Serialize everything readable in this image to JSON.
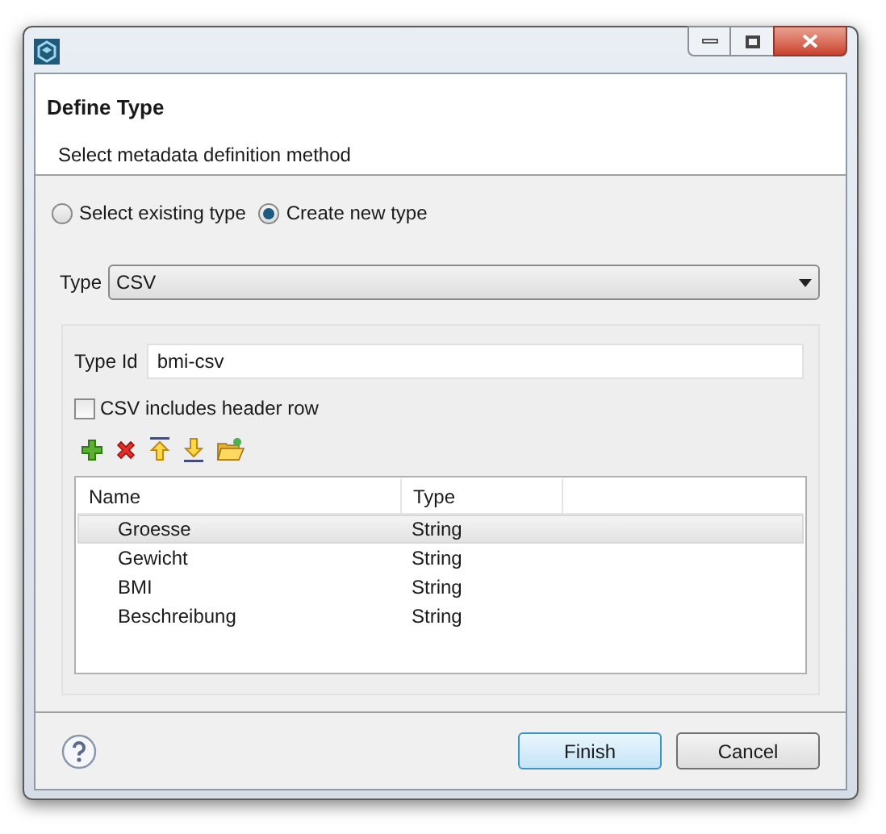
{
  "header": {
    "title": "Define Type",
    "subtitle": "Select metadata definition method"
  },
  "method_options": [
    {
      "label": "Select existing type",
      "selected": false
    },
    {
      "label": "Create new type",
      "selected": true
    }
  ],
  "type_field": {
    "label": "Type",
    "value": "CSV"
  },
  "type_id": {
    "label": "Type Id",
    "value": "bmi-csv"
  },
  "header_row_checkbox": {
    "label": "CSV includes header row",
    "checked": false
  },
  "toolbar": [
    {
      "kind": "add"
    },
    {
      "kind": "remove"
    },
    {
      "kind": "up"
    },
    {
      "kind": "down"
    },
    {
      "kind": "open"
    }
  ],
  "table": {
    "columns": [
      "Name",
      "Type"
    ],
    "rows": [
      {
        "cells": [
          "Groesse",
          "String"
        ],
        "selected": true
      },
      {
        "cells": [
          "Gewicht",
          "String"
        ],
        "selected": false
      },
      {
        "cells": [
          "BMI",
          "String"
        ],
        "selected": false
      },
      {
        "cells": [
          "Beschreibung",
          "String"
        ],
        "selected": false
      }
    ]
  },
  "buttons": [
    {
      "label": "Finish",
      "default": true
    },
    {
      "label": "Cancel",
      "default": false
    }
  ]
}
